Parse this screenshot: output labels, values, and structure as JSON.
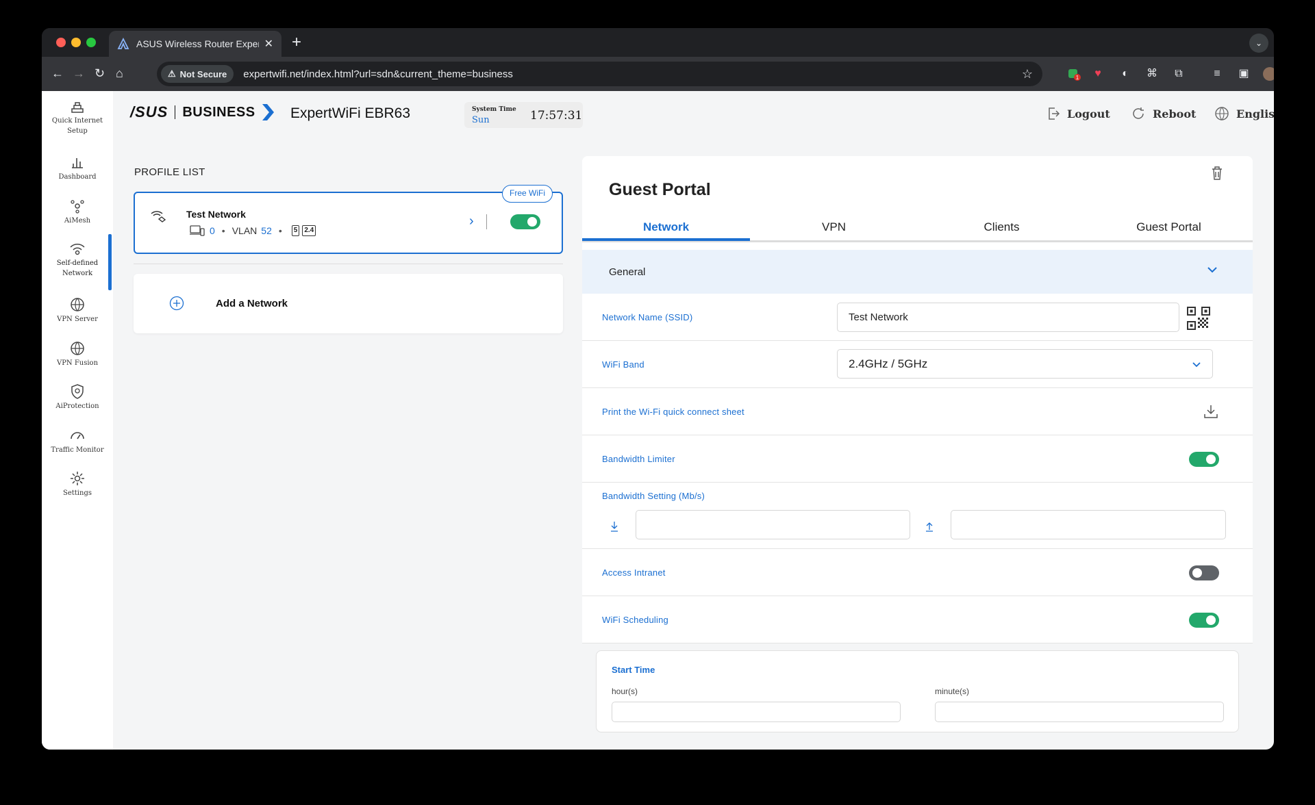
{
  "browser": {
    "tab_title": "ASUS Wireless Router Exper",
    "security_chip": "Not Secure",
    "url": "expertwifi.net/index.html?url=sdn&current_theme=business",
    "extension_badge": "1"
  },
  "sidebar": {
    "items": [
      {
        "label": "Quick Internet Setup"
      },
      {
        "label": "Dashboard"
      },
      {
        "label": "AiMesh"
      },
      {
        "label": "Self-defined Network"
      },
      {
        "label": "VPN Server"
      },
      {
        "label": "VPN Fusion"
      },
      {
        "label": "AiProtection"
      },
      {
        "label": "Traffic Monitor"
      },
      {
        "label": "Settings"
      }
    ]
  },
  "header": {
    "brand": "/SUS",
    "business": "BUSINESS",
    "model": "ExpertWiFi EBR63",
    "system_time_label": "System Time",
    "system_day": "Sun",
    "system_time": "17:57:31",
    "logout": "Logout",
    "reboot": "Reboot",
    "language": "English"
  },
  "profiles": {
    "title": "PROFILE LIST",
    "items": [
      {
        "name": "Test Network",
        "badge": "Free WiFi",
        "clients": "0",
        "vlan_label": "VLAN",
        "vlan": "52",
        "band_5": "5",
        "band_24": "2.4",
        "enabled": true
      }
    ],
    "add_label": "Add a Network"
  },
  "panel": {
    "title": "Guest Portal",
    "tabs": [
      "Network",
      "VPN",
      "Clients",
      "Guest Portal"
    ],
    "active_tab": "Network",
    "section": "General",
    "ssid_label": "Network Name (SSID)",
    "ssid_value": "Test Network",
    "band_label": "WiFi Band",
    "band_value": "2.4GHz / 5GHz",
    "print_label": "Print the Wi-Fi quick connect sheet",
    "bw_limiter_label": "Bandwidth Limiter",
    "bw_limiter": true,
    "bw_setting_label": "Bandwidth Setting (Mb/s)",
    "download_value": "",
    "upload_value": "",
    "intranet_label": "Access Intranet",
    "intranet": false,
    "scheduling_label": "WiFi Scheduling",
    "scheduling": true,
    "start_time_label": "Start Time",
    "hours_label": "hour(s)",
    "minutes_label": "minute(s)"
  },
  "colors": {
    "accent": "#1b6fd1",
    "toggle_on": "#23a86b",
    "toggle_off": "#5f6368",
    "section_bg": "#eaf2fb"
  }
}
